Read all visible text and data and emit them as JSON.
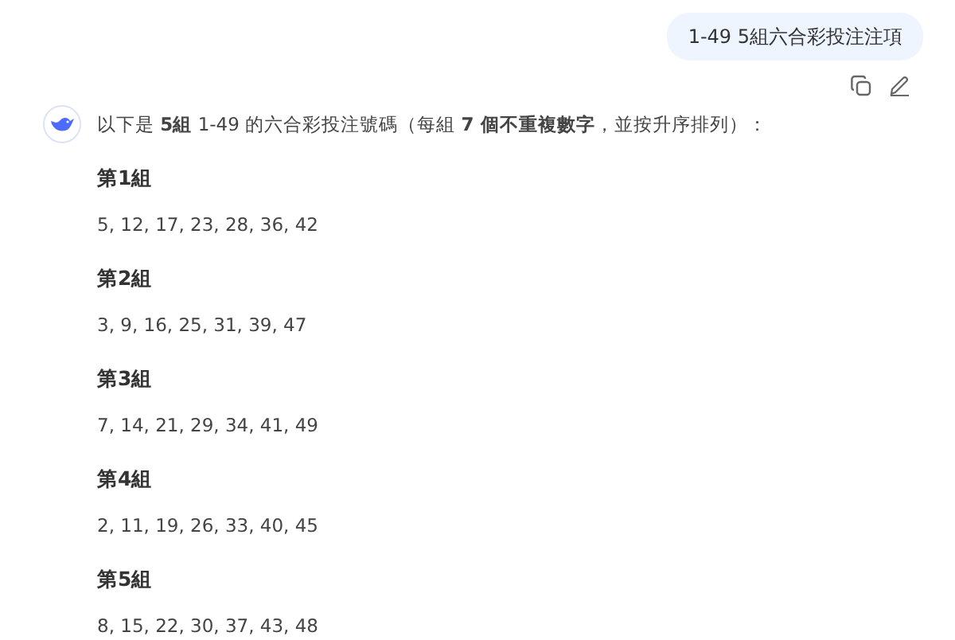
{
  "user_message": {
    "text": "1-49 5組六合彩投注注項"
  },
  "reply": {
    "intro": "以下是 **5組** 1-49 的六合彩投注號碼（每組 **7 個不重複數字**，並按升序排列）：",
    "groups": [
      {
        "title": "第1組",
        "numbers": "5, 12, 17, 23, 28, 36, 42"
      },
      {
        "title": "第2組",
        "numbers": "3, 9, 16, 25, 31, 39, 47"
      },
      {
        "title": "第3組",
        "numbers": "7, 14, 21, 29, 34, 41, 49"
      },
      {
        "title": "第4組",
        "numbers": "2, 11, 19, 26, 33, 40, 45"
      },
      {
        "title": "第5組",
        "numbers": "8, 15, 22, 30, 37, 43, 48"
      }
    ]
  }
}
